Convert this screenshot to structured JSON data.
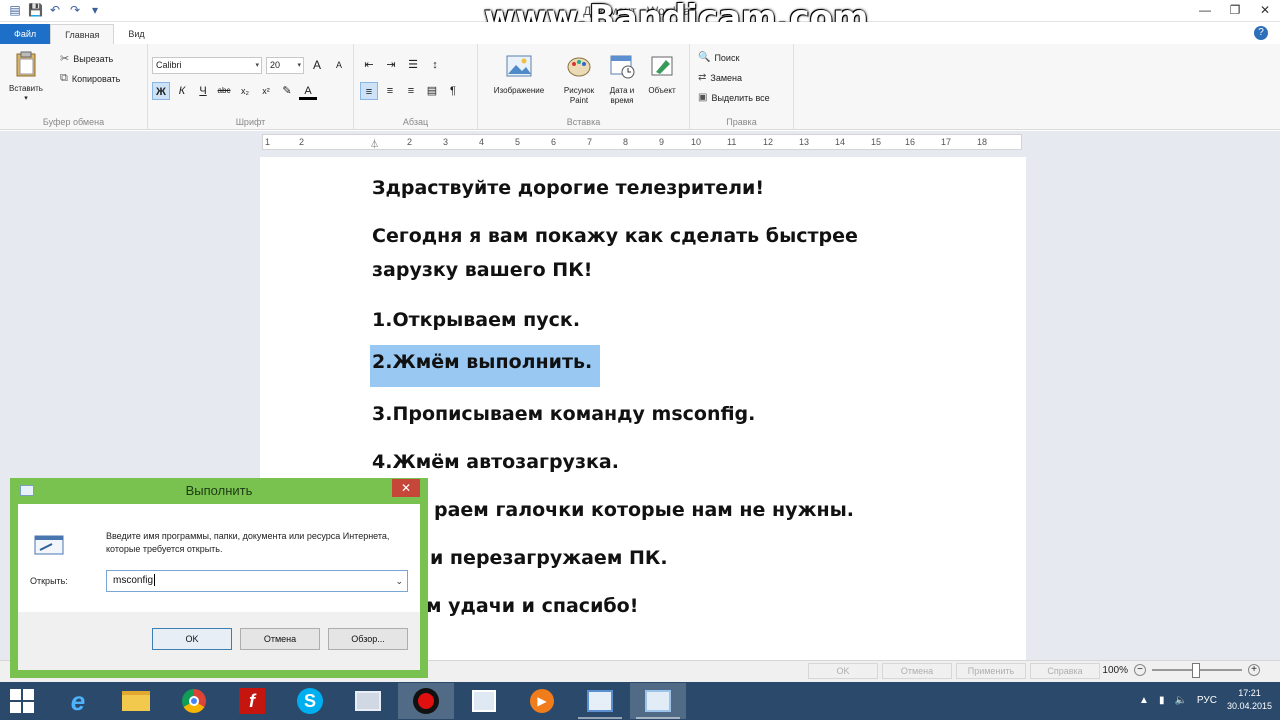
{
  "watermark": "www.Bandicam.com",
  "window": {
    "title": "Документ - WordPad",
    "controls": [
      "—",
      "❐",
      "✕"
    ]
  },
  "ribbon": {
    "tabs": [
      {
        "label": "Файл",
        "style": "file"
      },
      {
        "label": "Главная",
        "style": "active"
      },
      {
        "label": "Вид",
        "style": ""
      }
    ],
    "clipboard": {
      "group_label": "Буфер обмена",
      "paste_label": "Вставить",
      "cut_label": "Вырезать",
      "copy_label": "Копировать"
    },
    "font": {
      "group_label": "Шрифт",
      "font_name": "Calibri",
      "font_size": "20",
      "grow": "A",
      "shrink": "A",
      "bold": "Ж",
      "italic": "К",
      "underline": "Ч",
      "strike": "abc",
      "subscript": "x₂",
      "superscript": "x²",
      "text_color": "A"
    },
    "paragraph": {
      "group_label": "Абзац"
    },
    "insert": {
      "group_label": "Вставка",
      "picture_label": "Изображение",
      "paint_label_1": "Рисунок",
      "paint_label_2": "Paint",
      "datetime_label_1": "Дата и",
      "datetime_label_2": "время",
      "object_label": "Объект"
    },
    "editing": {
      "group_label": "Правка",
      "find_label": "Поиск",
      "replace_label": "Замена",
      "select_all_label": "Выделить все"
    }
  },
  "ruler": {
    "ticks": [
      "1",
      "2",
      "1",
      "2",
      "3",
      "4",
      "5",
      "6",
      "7",
      "8",
      "9",
      "10",
      "11",
      "12",
      "13",
      "14",
      "15",
      "16",
      "17",
      "18"
    ]
  },
  "document": {
    "lines": [
      "Здраствуйте дорогие телезрители!",
      "Сегодня я вам покажу как сделать быстрее",
      "зарузку вашего ПК!",
      "1.Открываем пуск.",
      "2.Жмём выполнить.",
      "3.Прописываем команду msconfig.",
      "4.Жмём автозагрузка.",
      "раем галочки которые нам не нужны.",
      "и перезагружаем ПК.",
      "м удачи и спасибо!"
    ],
    "highlight_color": "#99c9f3"
  },
  "statusbar": {
    "zoom": "100%",
    "zoom_level": 0.5,
    "ghost_buttons": [
      "OK",
      "Отмена",
      "Применить",
      "Справка"
    ]
  },
  "run_dialog": {
    "title": "Выполнить",
    "close": "✕",
    "description": "Введите имя программы, папки, документа или ресурса Интернета, которые требуется открыть.",
    "open_label": "Открыть:",
    "input_value": "msconfig",
    "ok": "OK",
    "cancel": "Отмена",
    "browse": "Обзор...",
    "frame_color": "#7ac250"
  },
  "taskbar": {
    "apps": [
      "internet-explorer",
      "file-explorer",
      "chrome",
      "flash",
      "skype",
      "display",
      "recorder",
      "photos",
      "media-player",
      "run-window",
      "wordpad"
    ],
    "tray_lang": "РУС",
    "time": "17:21",
    "date": "30.04.2015",
    "color": "#2b4a6b"
  }
}
